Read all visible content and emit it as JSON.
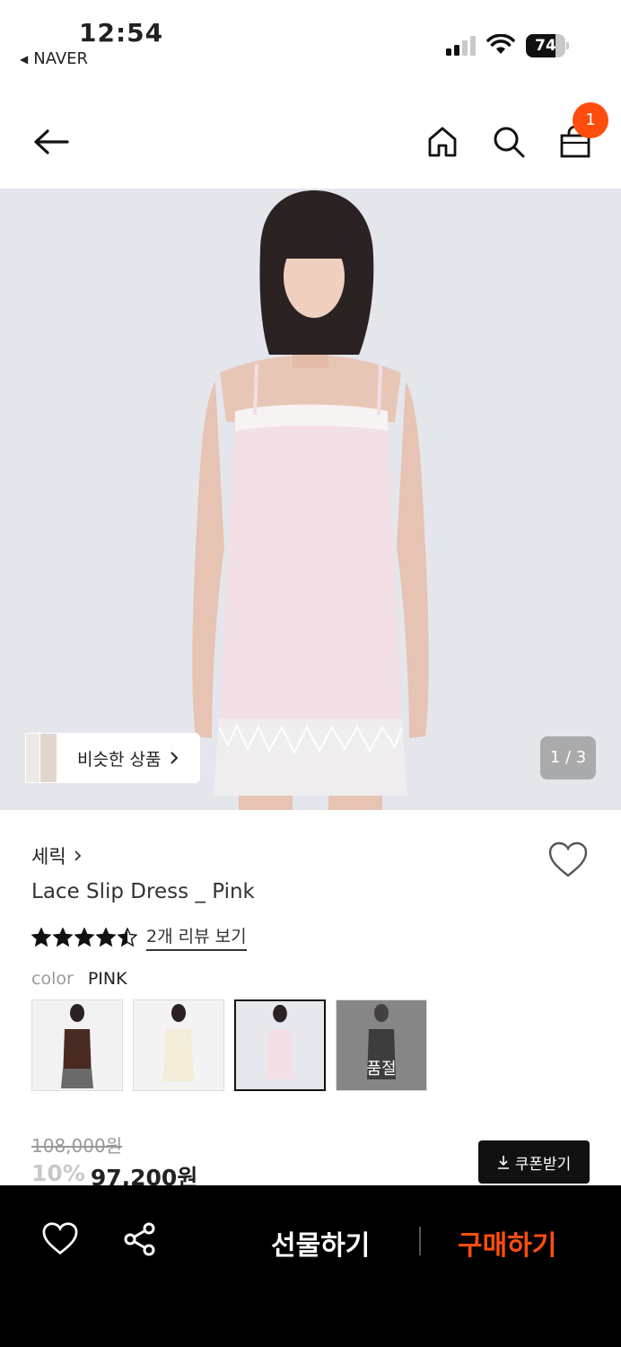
{
  "status_bar": {
    "time": "12:54",
    "back_app": "NAVER",
    "battery": "74",
    "battery_level": 0.74
  },
  "nav": {
    "back_icon": "arrow-left-icon",
    "home_icon": "home-icon",
    "search_icon": "search-icon",
    "bag_icon": "shopping-bag-icon",
    "cart_count": "1"
  },
  "gallery": {
    "similar_label": "비슷한 상품",
    "counter": "1 / 3"
  },
  "product": {
    "brand": "세릭",
    "name": "Lace Slip Dress _ Pink",
    "rating": 4.5,
    "review_link": "2개 리뷰 보기",
    "color_label": "color",
    "color_value": "PINK",
    "swatches": [
      {
        "label": "brown",
        "selected": false,
        "sold_out": false
      },
      {
        "label": "ivory",
        "selected": false,
        "sold_out": false
      },
      {
        "label": "pink",
        "selected": true,
        "sold_out": false
      },
      {
        "label": "black",
        "selected": false,
        "sold_out": true,
        "sold_text": "품절"
      }
    ],
    "original_price": "108,000원",
    "discount": "10%",
    "price": "97,200원",
    "coupon_label": "쿠폰받기"
  },
  "bottom_bar": {
    "gift_label": "선물하기",
    "buy_label": "구매하기",
    "accent": "#ff4d0d"
  }
}
